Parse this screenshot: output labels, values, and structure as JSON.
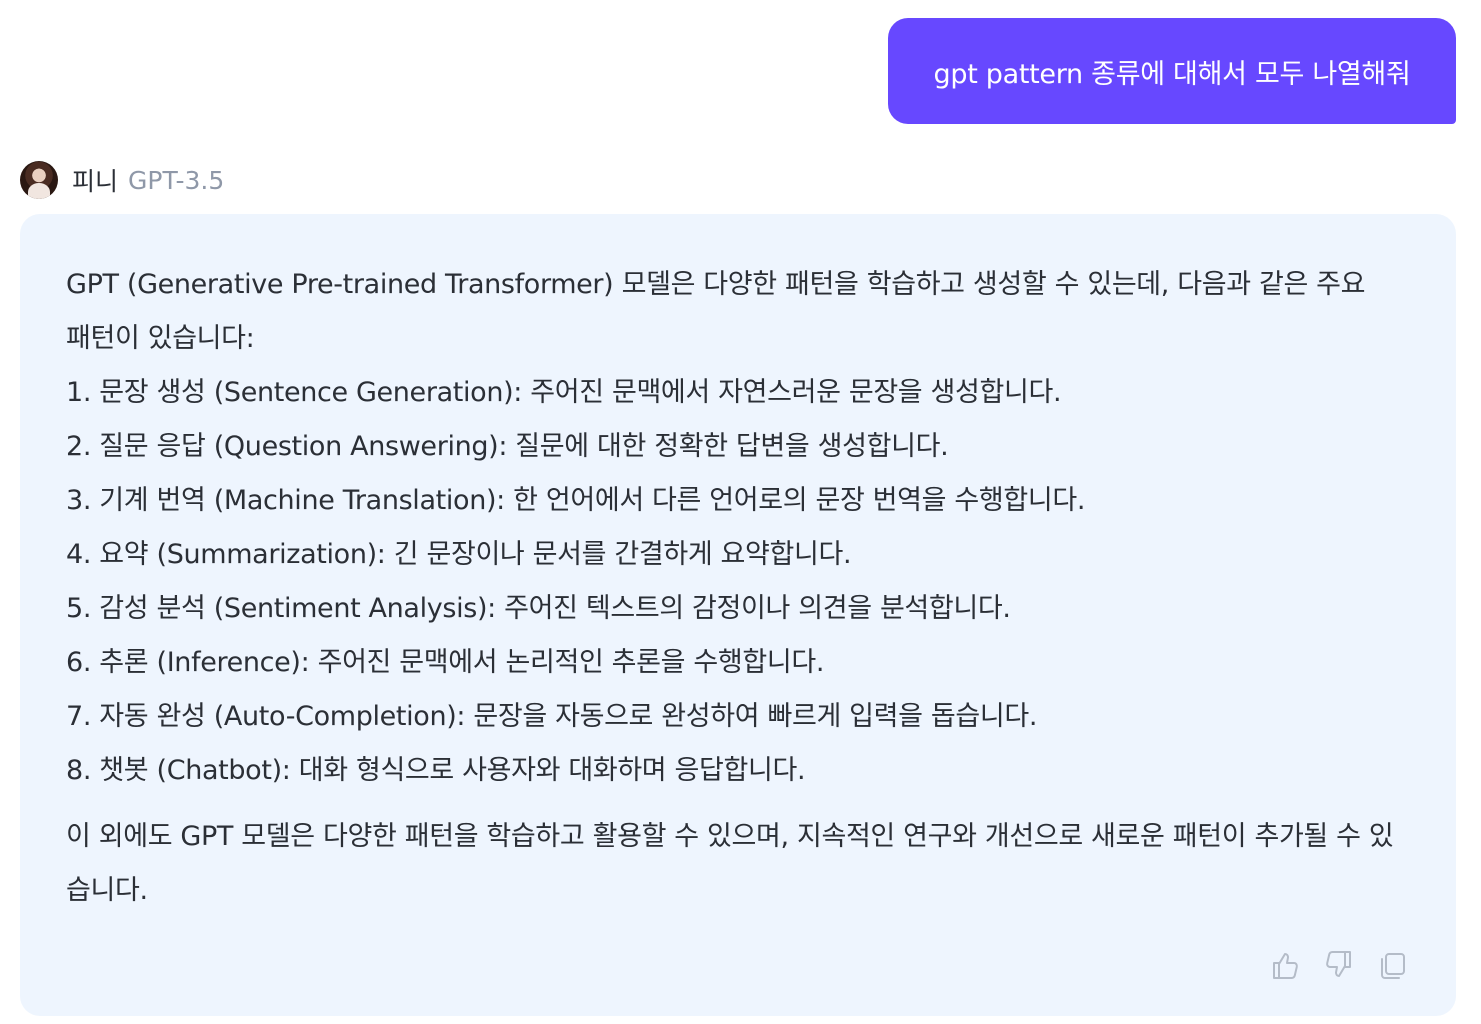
{
  "user_message": {
    "text": "gpt pattern 종류에 대해서 모두 나열해줘"
  },
  "bot": {
    "name": "피니",
    "model": "GPT-3.5",
    "avatar_icon": "user-avatar-photo"
  },
  "answer": {
    "intro": "GPT (Generative Pre-trained Transformer) 모델은 다양한 패턴을 학습하고 생성할 수 있는데, 다음과 같은 주요 패턴이 있습니다:",
    "items": [
      "1. 문장 생성 (Sentence Generation): 주어진 문맥에서 자연스러운 문장을 생성합니다.",
      "2. 질문 응답 (Question Answering): 질문에 대한 정확한 답변을 생성합니다.",
      "3. 기계 번역 (Machine Translation): 한 언어에서 다른 언어로의 문장 번역을 수행합니다.",
      "4. 요약 (Summarization): 긴 문장이나 문서를 간결하게 요약합니다.",
      "5. 감성 분석 (Sentiment Analysis): 주어진 텍스트의 감정이나 의견을 분석합니다.",
      "6. 추론 (Inference): 주어진 문맥에서 논리적인 추론을 수행합니다.",
      "7. 자동 완성 (Auto-Completion): 문장을 자동으로 완성하여 빠르게 입력을 돕습니다.",
      "8. 챗봇 (Chatbot): 대화 형식으로 사용자와 대화하며 응답합니다."
    ],
    "outro": "이 외에도 GPT 모델은 다양한 패턴을 학습하고 활용할 수 있으며, 지속적인 연구와 개선으로 새로운 패턴이 추가될 수 있습니다."
  },
  "actions": {
    "icons": [
      "thumbs-up-icon",
      "thumbs-down-icon",
      "copy-icon"
    ]
  },
  "colors": {
    "user_bubble": "#6748ff",
    "answer_background": "#eef5fe",
    "model_text": "#8f98a8",
    "icon": "#b4bcc8"
  }
}
